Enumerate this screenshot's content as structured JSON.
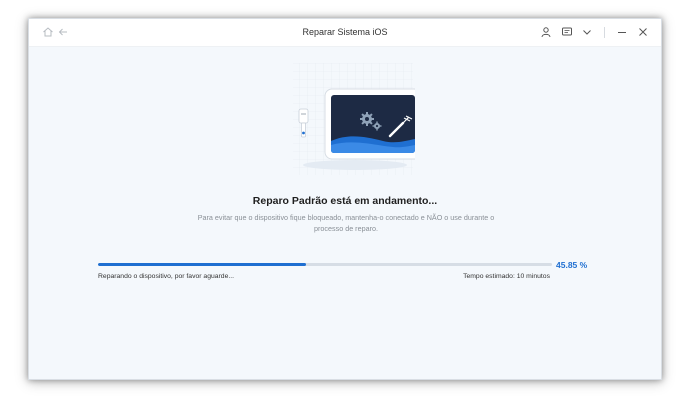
{
  "window": {
    "title": "Reparar Sistema iOS"
  },
  "toolbar_icons": [
    "home-icon",
    "back-arrow-icon",
    "user-icon",
    "feedback-icon",
    "chevron-down-icon",
    "minimize-icon",
    "close-icon"
  ],
  "main": {
    "heading": "Reparo Padrão está em andamento...",
    "description": "Para evitar que o dispositivo fique bloqueado, mantenha-o conectado e NÃO o use durante o processo de reparo."
  },
  "progress": {
    "value": 45.85,
    "label": "45.85 %",
    "status_text": "Reparando o dispositivo, por favor aguarde...",
    "estimate_text": "Tempo estimado: 10 minutos"
  },
  "colors": {
    "accent": "#1f6fd1",
    "background": "#f4f8fc",
    "device_screen": "#1d2a44"
  }
}
